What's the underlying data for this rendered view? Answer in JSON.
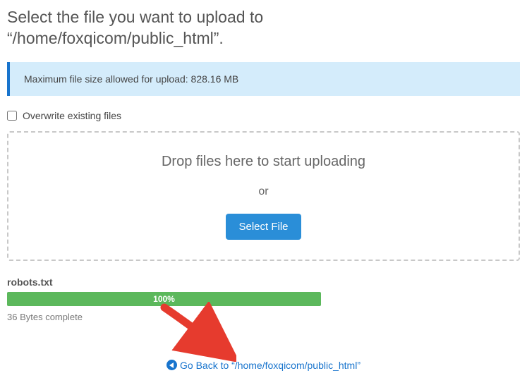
{
  "title_line1": "Select the file you want to upload to",
  "title_line2": "“/home/foxqicom/public_html”.",
  "info_message": "Maximum file size allowed for upload: 828.16 MB",
  "overwrite_label": "Overwrite existing files",
  "drop_heading": "Drop files here to start uploading",
  "or_text": "or",
  "select_button": "Select File",
  "upload": {
    "filename": "robots.txt",
    "progress_label": "100%",
    "complete_text": "36 Bytes complete"
  },
  "goback_label": "Go Back to “/home/foxqicom/public_html”"
}
